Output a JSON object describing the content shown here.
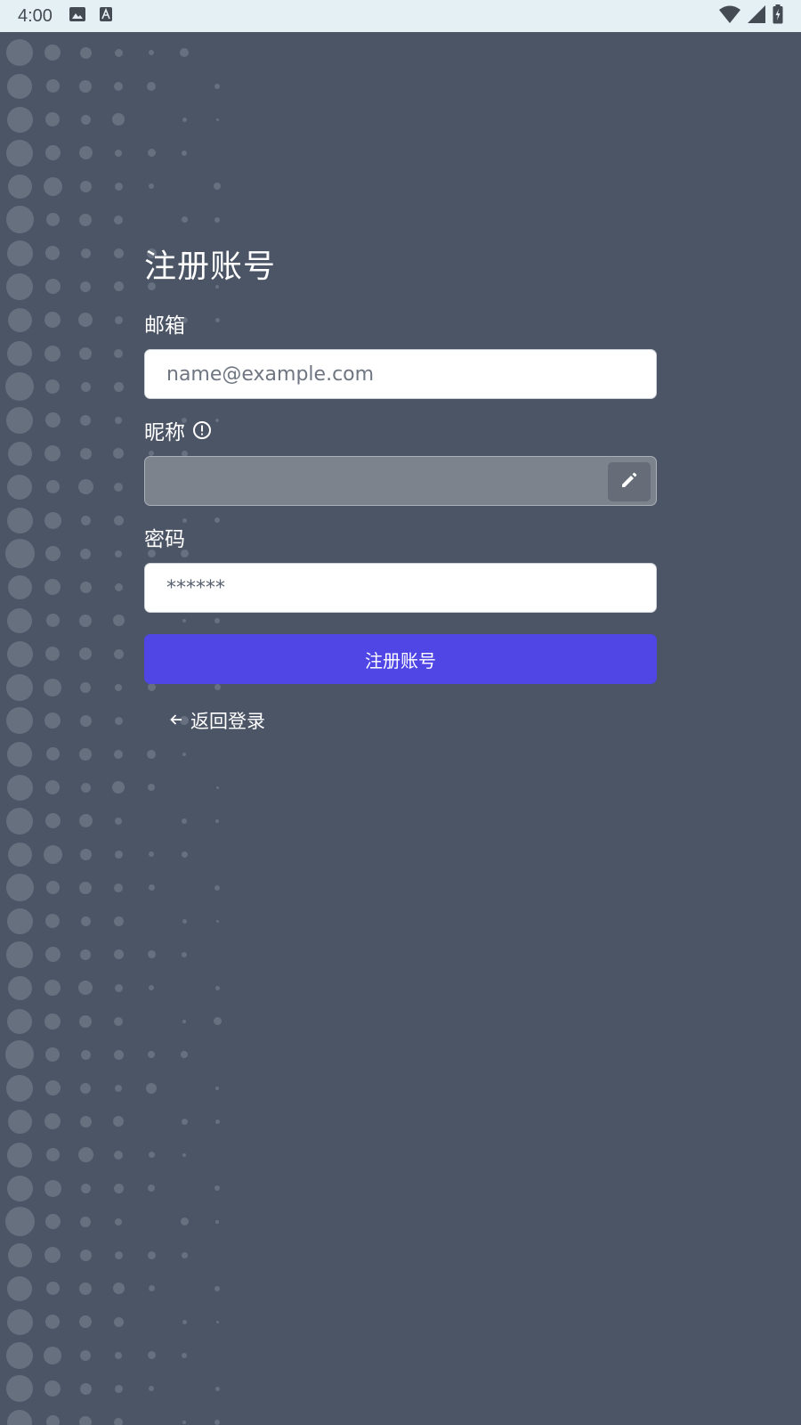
{
  "status_bar": {
    "time": "4:00",
    "left_icons": [
      "image-icon",
      "font-icon"
    ],
    "right_icons": [
      "wifi-icon",
      "signal-icon",
      "battery-charging-icon"
    ]
  },
  "form": {
    "title": "注册账号",
    "email": {
      "label": "邮箱",
      "placeholder": "name@example.com",
      "value": ""
    },
    "nickname": {
      "label": "昵称",
      "info_icon": "info-icon",
      "edit_icon": "edit-icon",
      "value": ""
    },
    "password": {
      "label": "密码",
      "value": "******"
    },
    "submit_label": "注册账号",
    "back_label": "返回登录",
    "back_icon": "arrow-left-icon"
  },
  "colors": {
    "background": "#4c5566",
    "accent": "#4f46e5",
    "status_bar": "#e4f0f3"
  }
}
